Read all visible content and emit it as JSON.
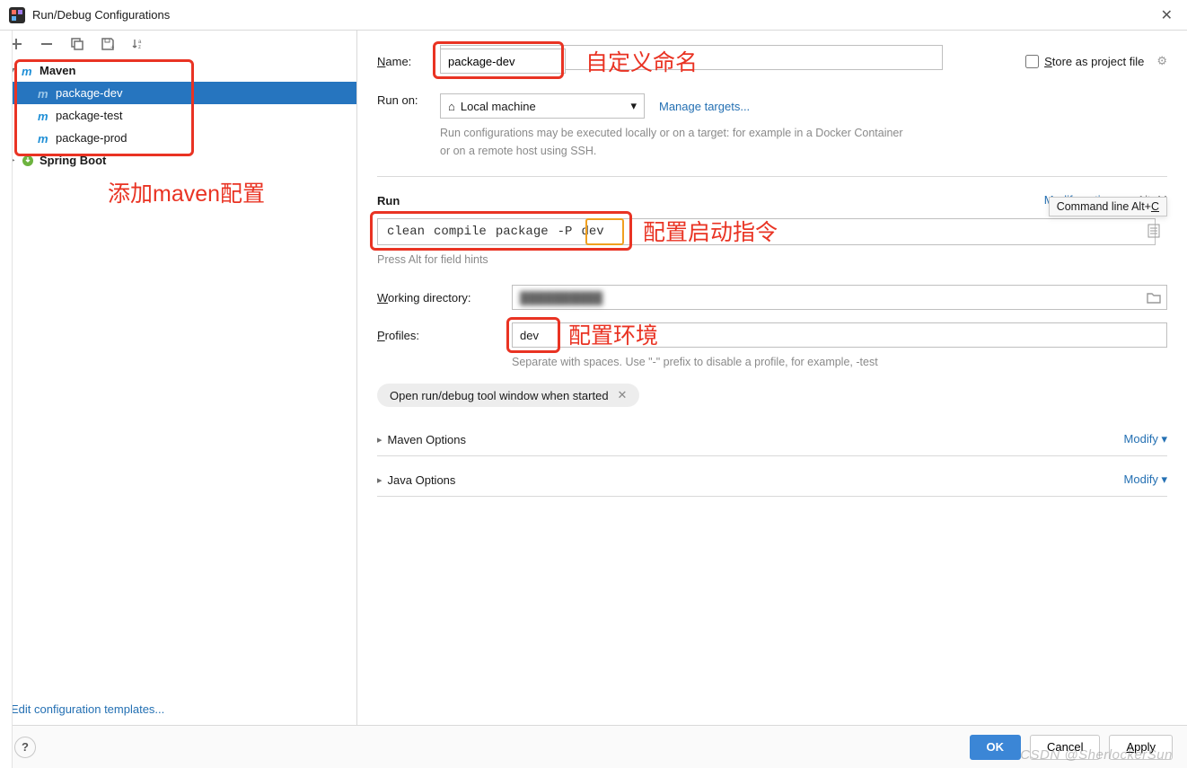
{
  "window": {
    "title": "Run/Debug Configurations"
  },
  "sidebar": {
    "annotation": "添加maven配置",
    "nodes": [
      {
        "label": "Maven",
        "type": "group",
        "expanded": true
      },
      {
        "label": "package-dev",
        "type": "maven",
        "selected": true
      },
      {
        "label": "package-test",
        "type": "maven"
      },
      {
        "label": "package-prod",
        "type": "maven"
      },
      {
        "label": "Spring Boot",
        "type": "group",
        "expanded": false
      }
    ],
    "edit_templates": "Edit configuration templates..."
  },
  "form": {
    "name_label": "Name:",
    "name_value": "package-dev",
    "name_annotation": "自定义命名",
    "store_label": "Store as project file",
    "runon_label": "Run on:",
    "runon_value": "Local machine",
    "manage_targets": "Manage targets...",
    "runon_hint": "Run configurations may be executed locally or on a target: for example in a Docker Container or on a remote host using SSH.",
    "run_header": "Run",
    "modify_options": "Modify options",
    "modify_shortcut": "Alt+M",
    "cmdline_tooltip": "Command line Alt+C",
    "cmdline_tokens": [
      "clean",
      "compile",
      "package",
      "-P",
      "dev"
    ],
    "cmdline_annotation": "配置启动指令",
    "cmdline_hint": "Press Alt for field hints",
    "working_dir_label": "Working directory:",
    "profiles_label": "Profiles:",
    "profiles_value": "dev",
    "profiles_annotation": "配置环境",
    "profiles_hint": "Separate with spaces. Use \"-\" prefix to disable a profile, for example, -test",
    "pill_label": "Open run/debug tool window when started",
    "maven_options": "Maven Options",
    "java_options": "Java Options",
    "modify": "Modify"
  },
  "footer": {
    "ok": "OK",
    "cancel": "Cancel",
    "apply": "Apply"
  },
  "watermark": "CSDN @SherlockerSun"
}
